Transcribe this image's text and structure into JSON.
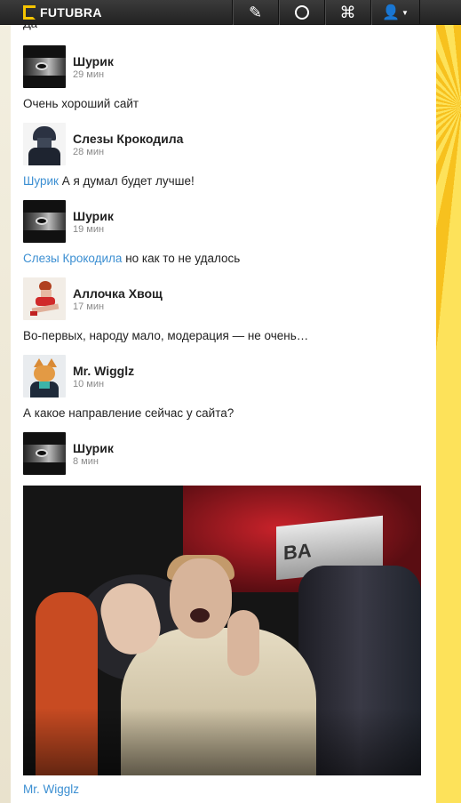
{
  "header": {
    "logo_text": "FUTUBRA",
    "nav": [
      {
        "icon": "compose-icon"
      },
      {
        "icon": "circle-icon"
      },
      {
        "icon": "command-icon"
      },
      {
        "icon": "user-icon"
      }
    ]
  },
  "feed": {
    "cut_text": "Да",
    "items": [
      {
        "author": "Шурик",
        "time": "29 мин",
        "avatar": "eye-avatar",
        "text": "Очень хороший сайт",
        "mention": ""
      },
      {
        "author": "Слезы Крокодила",
        "time": "28 мин",
        "avatar": "soldier-avatar",
        "mention": "Шурик",
        "text": " А я думал будет лучше!"
      },
      {
        "author": "Шурик",
        "time": "19 мин",
        "avatar": "eye-avatar",
        "mention": "Слезы Крокодила",
        "text": " но как то не удалось"
      },
      {
        "author": "Аллочка Хвощ",
        "time": "17 мин",
        "avatar": "pinup-avatar",
        "mention": "",
        "text": "Во-первых, народу мало, модерация — не очень…"
      },
      {
        "author": "Mr. Wigglz",
        "time": "10 мин",
        "avatar": "cat-mask-avatar",
        "mention": "",
        "text": "А какое направление сейчас у сайта?"
      },
      {
        "author": "Шурик",
        "time": "8 мин",
        "avatar": "eye-avatar",
        "mention": "",
        "text": ""
      }
    ],
    "photo_sign_text": "BA",
    "bottom_mention": "Mr. Wigglz"
  },
  "colors": {
    "mention": "#3c8fd2",
    "topbar": "#2a2a2a",
    "logo_accent": "#f5c400"
  }
}
